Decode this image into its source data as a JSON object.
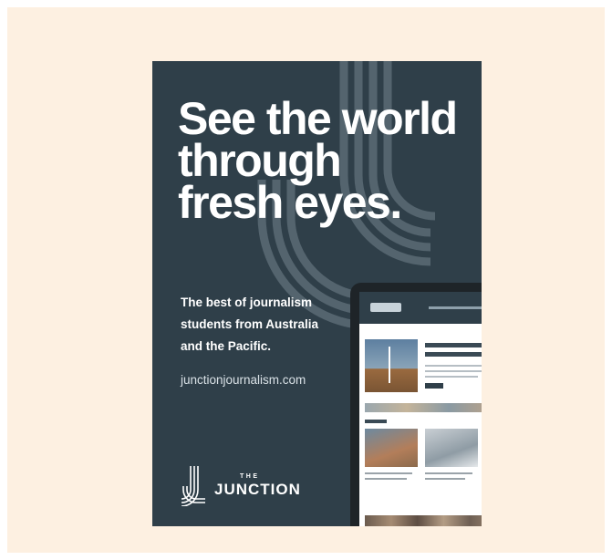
{
  "ad": {
    "headline_lines": [
      "See the world",
      "through",
      "fresh eyes."
    ],
    "tagline_lines": [
      "The best of journalism",
      "students from Australia",
      "and the Pacific."
    ],
    "url": "junctionjournalism.com",
    "logo": {
      "the": "THE",
      "name": "JUNCTION"
    }
  },
  "colors": {
    "page_background": "#fdf0e1",
    "ad_background": "#2f3f49",
    "text": "#ffffff",
    "brand_mark_lines": "#5b6b75"
  },
  "icons": {
    "logo_mark": "junction-lines-icon",
    "background_mark": "junction-lines-watermark-icon"
  }
}
